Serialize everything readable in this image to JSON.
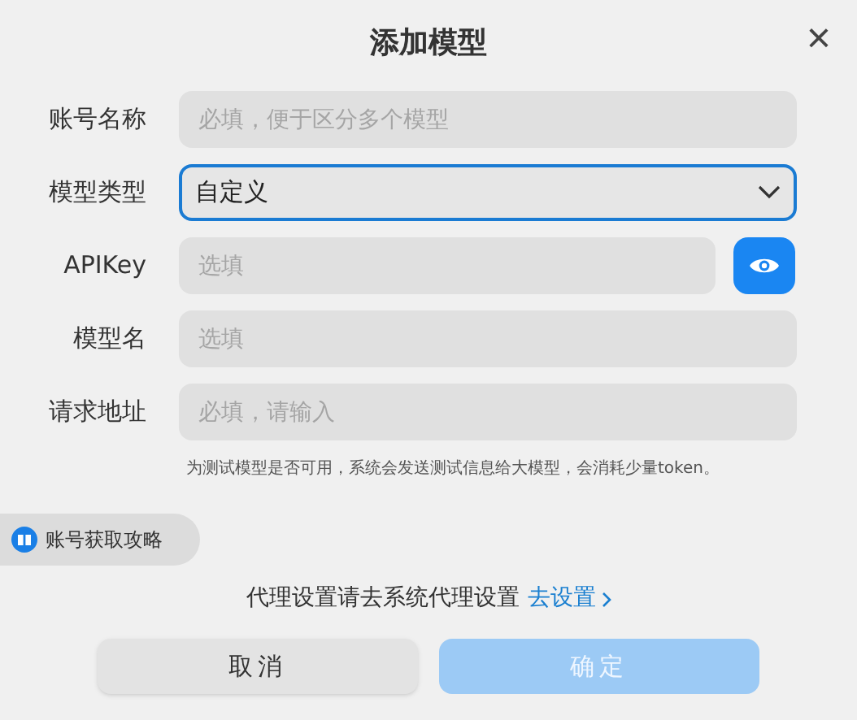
{
  "dialog": {
    "title": "添加模型",
    "close": "×"
  },
  "fields": [
    {
      "kind": "text",
      "label": "账号名称",
      "placeholder": "必填，便于区分多个模型",
      "focused": false,
      "reveal_button": false
    },
    {
      "kind": "select",
      "label": "模型类型",
      "value": "自定义",
      "focused": true,
      "reveal_button": false
    },
    {
      "kind": "text",
      "label": "APIKey",
      "placeholder": "选填",
      "focused": false,
      "reveal_button": true
    },
    {
      "kind": "text",
      "label": "模型名",
      "placeholder": "选填",
      "focused": false,
      "reveal_button": false
    },
    {
      "kind": "text",
      "label": "请求地址",
      "placeholder": "必填，请输入",
      "focused": false,
      "reveal_button": false
    }
  ],
  "note": "为测试模型是否可用，系统会发送测试信息给大模型，会消耗少量token。",
  "guide_button": "账号获取攻略",
  "proxy": {
    "text": "代理设置请去系统代理设置",
    "link": "去设置"
  },
  "buttons": [
    {
      "label": "取消",
      "kind": "secondary",
      "disabled": false
    },
    {
      "label": "确定",
      "kind": "primary",
      "disabled": true
    }
  ]
}
